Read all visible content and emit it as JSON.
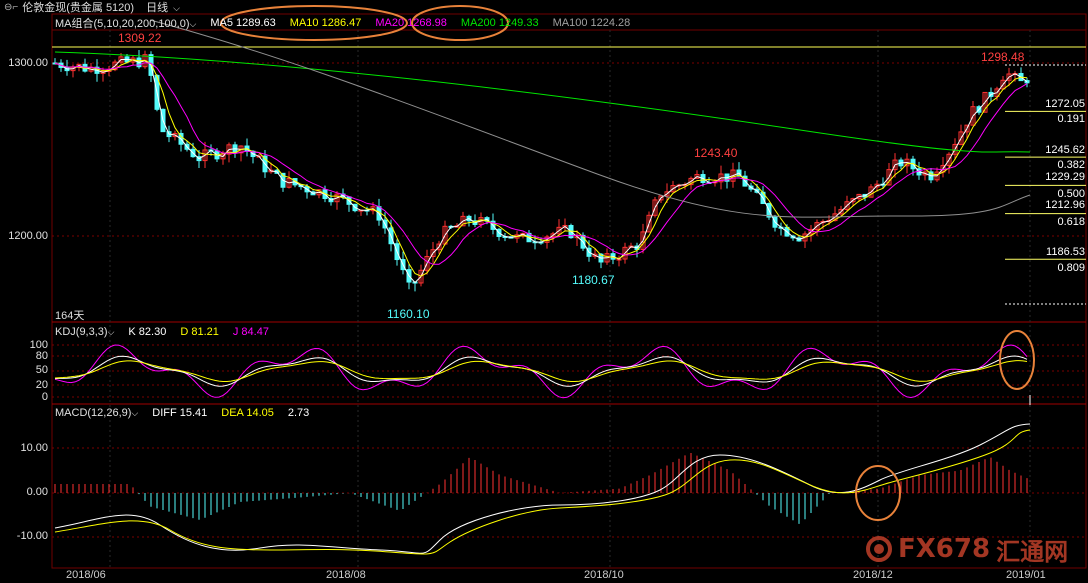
{
  "window": {
    "instrument_name": "伦敦金现",
    "instrument_group": "(贵金属 5120)",
    "period": "日线",
    "period_chevron": "chevron-down-icon"
  },
  "main_panel": {
    "legend": {
      "ma_group": "MA组合(5,10,20,200,100,0)",
      "ma5": "MA5 1289.63",
      "ma10": "MA10 1286.47",
      "ma20": "MA20 1268.98",
      "ma200": "MA200 1249.33",
      "ma100": "MA100 1224.28"
    },
    "y_labels": [
      "1300.00",
      "1200.00"
    ],
    "days_label": "164天",
    "annotations": {
      "high_left": "1309.22",
      "low": "1160.10",
      "mid_high": "1243.40",
      "mid_low": "1180.67",
      "recent_high": "1298.48"
    },
    "fib_levels": [
      {
        "price": "1272.05",
        "ratio": "0.191"
      },
      {
        "price": "1245.62",
        "ratio": "0.382"
      },
      {
        "price": "1229.29",
        "ratio": "0.500"
      },
      {
        "price": "1212.96",
        "ratio": "0.618"
      },
      {
        "price": "1186.53",
        "ratio": "0.809"
      }
    ]
  },
  "kdj_panel": {
    "name": "KDJ(9,3,3)",
    "k": "K 82.30",
    "d": "D 81.21",
    "j": "J 84.47",
    "y_labels": [
      "100",
      "80",
      "50",
      "20",
      "0"
    ]
  },
  "macd_panel": {
    "name": "MACD(12,26,9)",
    "diff": "DIFF 15.41",
    "dea": "DEA 14.05",
    "macd": "2.73",
    "y_labels": [
      "10.00",
      "0.00",
      "-10.00"
    ]
  },
  "x_axis": [
    "2018/06",
    "2018/08",
    "2018/10",
    "2018/12",
    "2019/01"
  ],
  "watermark": {
    "brand": "FX678",
    "sub": "汇通网"
  },
  "colors": {
    "up": "#ff3232",
    "down": "#54fcfc",
    "ma5": "#ffffff",
    "ma10": "#ffff00",
    "ma20": "#ff00ff",
    "ma200": "#00e600",
    "ma100": "#909090",
    "highlight_circle": "#e8823a",
    "grid_red": "#7a0000"
  }
}
